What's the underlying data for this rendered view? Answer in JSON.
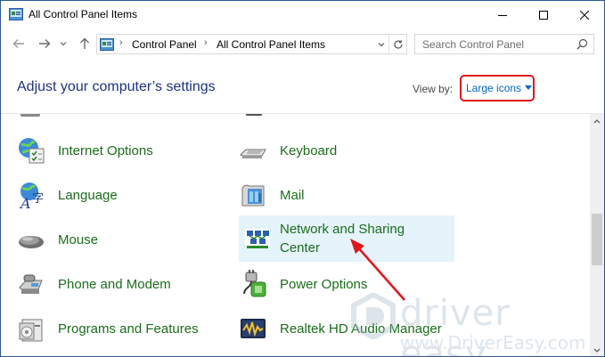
{
  "window": {
    "title": "All Control Panel Items"
  },
  "address_bar": {
    "breadcrumbs": [
      "Control Panel",
      "All Control Panel Items"
    ]
  },
  "search": {
    "placeholder": "Search Control Panel"
  },
  "header": {
    "heading": "Adjust your computer’s settings",
    "view_by_label": "View by:",
    "view_by_value": "Large icons"
  },
  "items": {
    "internet_options": "Internet Options",
    "keyboard": "Keyboard",
    "language": "Language",
    "mail": "Mail",
    "mouse": "Mouse",
    "network_line1": "Network and Sharing",
    "network_line2": "Center",
    "phone_modem": "Phone and Modem",
    "power_options": "Power Options",
    "programs_features": "Programs and Features",
    "realtek": "Realtek HD Audio Manager"
  },
  "watermark": {
    "brand": "driver easy",
    "url": "www.DriverEasy.com"
  },
  "colors": {
    "item_label": "#1b6e1b",
    "heading": "#1e3287",
    "link": "#0066cc",
    "highlight": "#e5f3fb",
    "annotation_red": "#e0161e"
  }
}
